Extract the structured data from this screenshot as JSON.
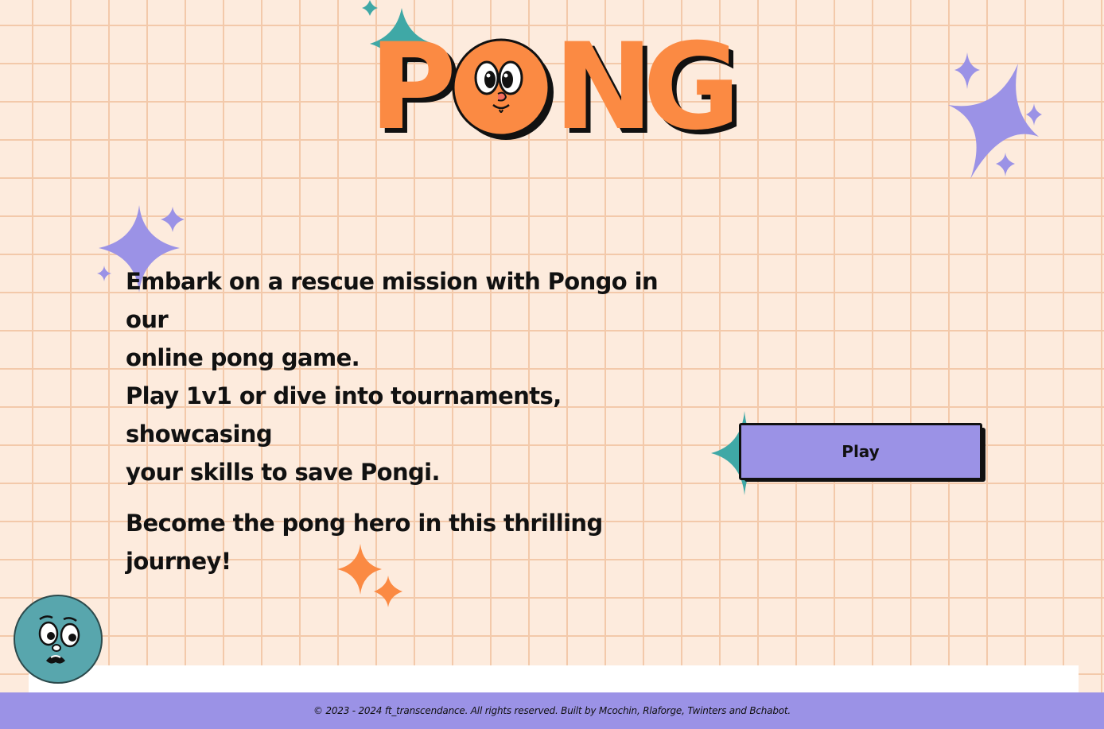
{
  "title": {
    "letters": [
      "P",
      "N",
      "G"
    ],
    "accent_color": "#fb8a43",
    "shadow_color": "#111111"
  },
  "intro": {
    "line1": "Embark on a rescue mission with Pongo in our",
    "line2": "online pong game.",
    "line3": "Play 1v1 or dive into tournaments, showcasing",
    "line4": "your skills to save Pongi.",
    "line5": "Become the pong hero in this thrilling journey!"
  },
  "play_button": {
    "label": "Play",
    "color": "#9b92e6"
  },
  "footer": {
    "text": "© 2023 - 2024 ft_transcendance. All rights reserved. Built by Mcochin, Rlaforge, Twinters and Bchabot."
  },
  "colors": {
    "background": "#fdebdd",
    "grid": "#f3c9aa",
    "purple": "#9b92e6",
    "teal": "#3fa8a6",
    "orange": "#fb8a43",
    "mascot_blue": "#58a6ad"
  },
  "icons": [
    "sparkle-icon",
    "pongo-face-icon",
    "worried-face-icon"
  ]
}
